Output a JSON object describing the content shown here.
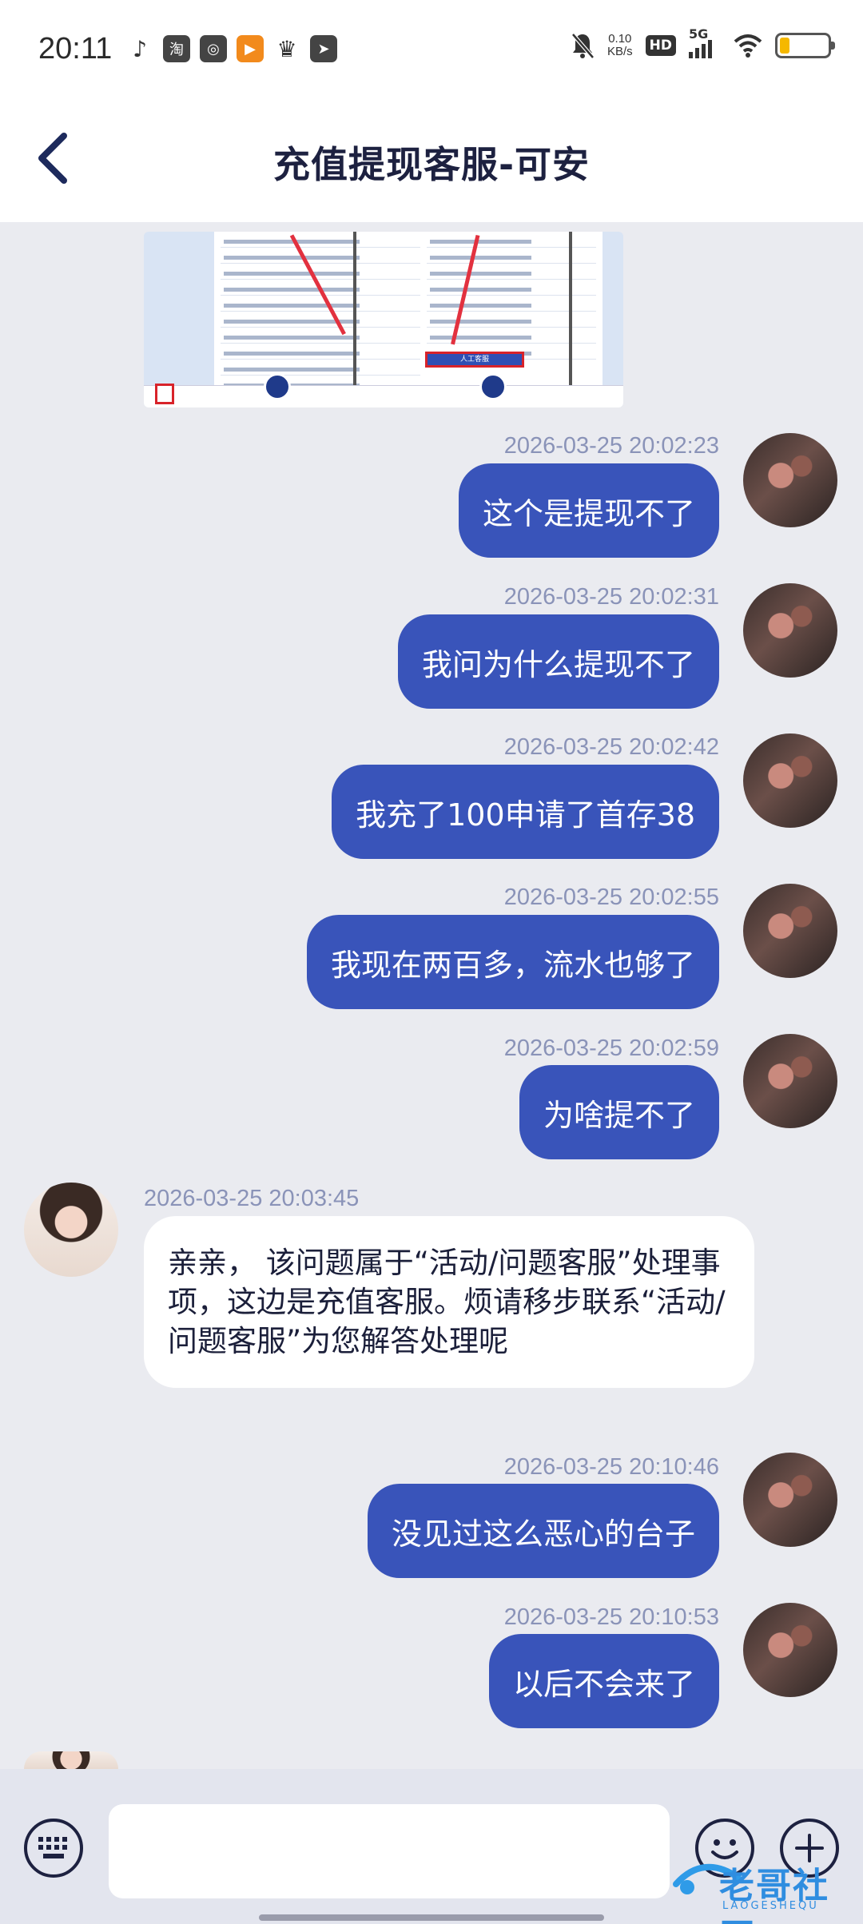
{
  "status_bar": {
    "time": "20:11",
    "net_speed_value": "0.10",
    "net_speed_unit": "KB/s",
    "hd": "HD",
    "network": "5G",
    "battery_level": 0.2,
    "battery_color": "#f5b800"
  },
  "header": {
    "title": "充值提现客服-可安"
  },
  "messages": [
    {
      "sender": "me",
      "time": "2026-03-25 20:02:23",
      "text": "这个是提现不了"
    },
    {
      "sender": "me",
      "time": "2026-03-25 20:02:31",
      "text": "我问为什么提现不了"
    },
    {
      "sender": "me",
      "time": "2026-03-25 20:02:42",
      "text": "我充了100申请了首存38"
    },
    {
      "sender": "me",
      "time": "2026-03-25 20:02:55",
      "text": "我现在两百多，流水也够了"
    },
    {
      "sender": "me",
      "time": "2026-03-25 20:02:59",
      "text": "为啥提不了"
    },
    {
      "sender": "agent",
      "time": "2026-03-25 20:03:45",
      "text": "亲亲， 该问题属于“活动/问题客服”处理事项，这边是充值客服。烦请移步联系“活动/问题客服”为您解答处理呢"
    },
    {
      "sender": "me",
      "time": "2026-03-25 20:10:46",
      "text": "没见过这么恶心的台子"
    },
    {
      "sender": "me",
      "time": "2026-03-25 20:10:53",
      "text": "以后不会来了"
    }
  ],
  "shared_image": {
    "button_label": "人工客服"
  },
  "input": {
    "value": "",
    "placeholder": ""
  },
  "watermark": {
    "text": "老哥社区",
    "subtext": "LAOGESHEQU"
  },
  "colors": {
    "accent": "#3954ba",
    "background": "#eaebf0",
    "timestamp": "#8a93b8"
  },
  "icons": {
    "back": "chevron-left-icon",
    "keyboard": "keyboard-icon",
    "emoji": "emoji-icon",
    "plus": "plus-icon"
  }
}
